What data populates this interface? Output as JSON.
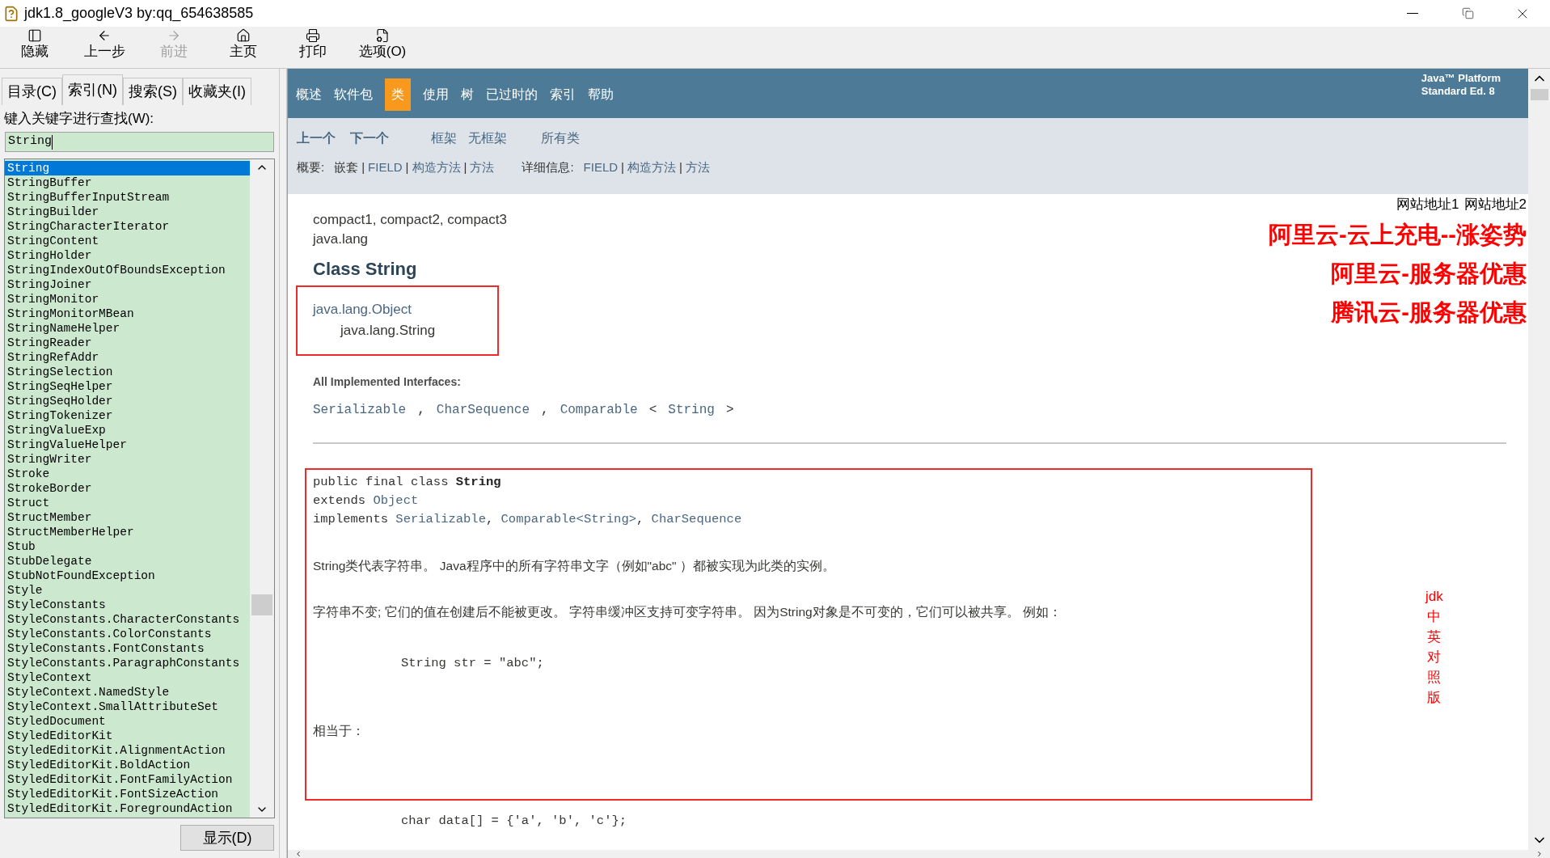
{
  "window": {
    "title": "jdk1.8_googleV3 by:qq_654638585"
  },
  "toolbar": [
    {
      "label": "隐藏",
      "kind": "hide",
      "disabled": false
    },
    {
      "label": "上一步",
      "kind": "back",
      "disabled": false
    },
    {
      "label": "前进",
      "kind": "forward",
      "disabled": true
    },
    {
      "label": "主页",
      "kind": "home",
      "disabled": false
    },
    {
      "label": "打印",
      "kind": "print",
      "disabled": false
    },
    {
      "label": "选项(O)",
      "kind": "options",
      "disabled": false
    }
  ],
  "tabs": [
    {
      "label": "目录(C)",
      "selected": false
    },
    {
      "label": "索引(N)",
      "selected": true
    },
    {
      "label": "搜索(S)",
      "selected": false
    },
    {
      "label": "收藏夹(I)",
      "selected": false
    }
  ],
  "search": {
    "label": "键入关键字进行查找(W):",
    "value": "String"
  },
  "index_list": [
    {
      "text": "String",
      "selected": true
    },
    {
      "text": "StringBuffer",
      "selected": false
    },
    {
      "text": "StringBufferInputStream",
      "selected": false
    },
    {
      "text": "StringBuilder",
      "selected": false
    },
    {
      "text": "StringCharacterIterator",
      "selected": false
    },
    {
      "text": "StringContent",
      "selected": false
    },
    {
      "text": "StringHolder",
      "selected": false
    },
    {
      "text": "StringIndexOutOfBoundsException",
      "selected": false
    },
    {
      "text": "StringJoiner",
      "selected": false
    },
    {
      "text": "StringMonitor",
      "selected": false
    },
    {
      "text": "StringMonitorMBean",
      "selected": false
    },
    {
      "text": "StringNameHelper",
      "selected": false
    },
    {
      "text": "StringReader",
      "selected": false
    },
    {
      "text": "StringRefAddr",
      "selected": false
    },
    {
      "text": "StringSelection",
      "selected": false
    },
    {
      "text": "StringSeqHelper",
      "selected": false
    },
    {
      "text": "StringSeqHolder",
      "selected": false
    },
    {
      "text": "StringTokenizer",
      "selected": false
    },
    {
      "text": "StringValueExp",
      "selected": false
    },
    {
      "text": "StringValueHelper",
      "selected": false
    },
    {
      "text": "StringWriter",
      "selected": false
    },
    {
      "text": "Stroke",
      "selected": false
    },
    {
      "text": "StrokeBorder",
      "selected": false
    },
    {
      "text": "Struct",
      "selected": false
    },
    {
      "text": "StructMember",
      "selected": false
    },
    {
      "text": "StructMemberHelper",
      "selected": false
    },
    {
      "text": "Stub",
      "selected": false
    },
    {
      "text": "StubDelegate",
      "selected": false
    },
    {
      "text": "StubNotFoundException",
      "selected": false
    },
    {
      "text": "Style",
      "selected": false
    },
    {
      "text": "StyleConstants",
      "selected": false
    },
    {
      "text": "StyleConstants.CharacterConstants",
      "selected": false
    },
    {
      "text": "StyleConstants.ColorConstants",
      "selected": false
    },
    {
      "text": "StyleConstants.FontConstants",
      "selected": false
    },
    {
      "text": "StyleConstants.ParagraphConstants",
      "selected": false
    },
    {
      "text": "StyleContext",
      "selected": false
    },
    {
      "text": "StyleContext.NamedStyle",
      "selected": false
    },
    {
      "text": "StyleContext.SmallAttributeSet",
      "selected": false
    },
    {
      "text": "StyledDocument",
      "selected": false
    },
    {
      "text": "StyledEditorKit",
      "selected": false
    },
    {
      "text": "StyledEditorKit.AlignmentAction",
      "selected": false
    },
    {
      "text": "StyledEditorKit.BoldAction",
      "selected": false
    },
    {
      "text": "StyledEditorKit.FontFamilyAction",
      "selected": false
    },
    {
      "text": "StyledEditorKit.FontSizeAction",
      "selected": false
    },
    {
      "text": "StyledEditorKit.ForegroundAction",
      "selected": false
    }
  ],
  "display_button": "显示(D)",
  "nav": [
    {
      "label": "概述",
      "selected": false
    },
    {
      "label": "软件包",
      "selected": false
    },
    {
      "label": "类",
      "selected": true
    },
    {
      "label": "使用",
      "selected": false
    },
    {
      "label": "树",
      "selected": false
    },
    {
      "label": "已过时的",
      "selected": false
    },
    {
      "label": "索引",
      "selected": false
    },
    {
      "label": "帮助",
      "selected": false
    }
  ],
  "platform": [
    "Java™ Platform",
    "Standard Ed. 8"
  ],
  "subnav": [
    {
      "text": "上一个",
      "kind": "bold"
    },
    {
      "text": "下一个",
      "kind": "bold"
    },
    {
      "text": "框架",
      "kind": "link"
    },
    {
      "text": "无框架",
      "kind": "link"
    },
    {
      "text": "所有类",
      "kind": "link"
    }
  ],
  "summary": [
    {
      "label": "概要:",
      "items": [
        {
          "text": "嵌套",
          "kind": "text"
        },
        {
          "text": "|",
          "kind": "sep"
        },
        {
          "text": "FIELD",
          "kind": "link"
        },
        {
          "text": "|",
          "kind": "sep"
        },
        {
          "text": "构造方法",
          "kind": "link"
        },
        {
          "text": "|",
          "kind": "sep"
        },
        {
          "text": "方法",
          "kind": "link"
        }
      ]
    },
    {
      "label": "详细信息:",
      "items": [
        {
          "text": "FIELD",
          "kind": "link"
        },
        {
          "text": "|",
          "kind": "sep"
        },
        {
          "text": "构造方法",
          "kind": "link"
        },
        {
          "text": "|",
          "kind": "sep"
        },
        {
          "text": "方法",
          "kind": "link"
        }
      ]
    }
  ],
  "site_links": [
    "网站地址1",
    "网站地址2"
  ],
  "ads": [
    "阿里云-云上充电--涨姿势",
    "阿里云-服务器优惠",
    "腾讯云-服务器优惠"
  ],
  "profiles": "compact1, compact2, compact3",
  "package": "java.lang",
  "class_title": "Class String",
  "hierarchy": [
    "java.lang.Object",
    "java.lang.String"
  ],
  "interfaces_label": "All Implemented Interfaces:",
  "interfaces": [
    {
      "text": "Serializable",
      "kind": "link"
    },
    {
      "text": ",",
      "kind": "text"
    },
    {
      "text": "CharSequence",
      "kind": "link"
    },
    {
      "text": ",",
      "kind": "text"
    },
    {
      "text": "Comparable",
      "kind": "link"
    },
    {
      "text": "<",
      "kind": "text"
    },
    {
      "text": "String",
      "kind": "link"
    },
    {
      "text": ">",
      "kind": "text"
    }
  ],
  "declaration": [
    [
      {
        "text": "public final class ",
        "kind": "text"
      },
      {
        "text": "String",
        "kind": "bold"
      }
    ],
    [
      {
        "text": "extends ",
        "kind": "text"
      },
      {
        "text": "Object",
        "kind": "link"
      }
    ],
    [
      {
        "text": "implements ",
        "kind": "text"
      },
      {
        "text": "Serializable",
        "kind": "link"
      },
      {
        "text": ", ",
        "kind": "text"
      },
      {
        "text": "Comparable<String>",
        "kind": "link"
      },
      {
        "text": ", ",
        "kind": "text"
      },
      {
        "text": "CharSequence",
        "kind": "link"
      }
    ]
  ],
  "description": [
    {
      "text": "String类代表字符串。 Java程序中的所有字符串文字（例如\"abc\" ）都被实现为此类的实例。",
      "kind": "para"
    },
    {
      "text": "字符串不变; 它们的值在创建后不能被更改。 字符串缓冲区支持可变字符串。 因为String对象是不可变的，它们可以被共享。 例如：",
      "kind": "para"
    },
    {
      "text": "String str = \"abc\";",
      "kind": "code"
    },
    {
      "text": "相当于：",
      "kind": "para"
    }
  ],
  "after_box": "char data[] = {'a', 'b', 'c'};",
  "side_label": [
    "jdk",
    "中",
    "英",
    "对",
    "照",
    "版"
  ]
}
